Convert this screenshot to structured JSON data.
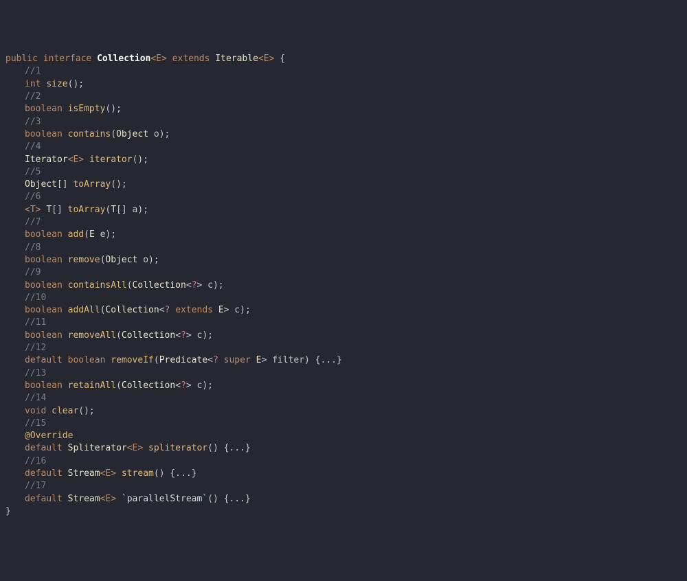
{
  "code": {
    "declaration": {
      "modifiers": "public interface",
      "name": "Collection",
      "generic": "<E>",
      "extends_kw": "extends",
      "super": "Iterable",
      "super_generic": "<E>",
      "open": "{"
    },
    "members": [
      {
        "comment": "//1",
        "tokens": [
          "int",
          " ",
          "size",
          "();"
        ]
      },
      {
        "comment": "//2",
        "tokens": [
          "boolean",
          " ",
          "isEmpty",
          "();"
        ]
      },
      {
        "comment": "//3",
        "tokens": [
          "boolean",
          " ",
          "contains",
          "(",
          "Object",
          " o);"
        ]
      },
      {
        "comment": "//4",
        "tokens": [
          "Iterator",
          "<E>",
          " ",
          "iterator",
          "();"
        ]
      },
      {
        "comment": "//5",
        "tokens": [
          "Object",
          "[] ",
          "toArray",
          "();"
        ]
      },
      {
        "comment": "//6",
        "tokens": [
          "<T>",
          " ",
          "T",
          "[] ",
          "toArray",
          "(",
          "T",
          "[] a);"
        ]
      },
      {
        "comment": "//7",
        "tokens": [
          "boolean",
          " ",
          "add",
          "(",
          "E",
          " e);"
        ]
      },
      {
        "comment": "//8",
        "tokens": [
          "boolean",
          " ",
          "remove",
          "(",
          "Object",
          " o);"
        ]
      },
      {
        "comment": "//9",
        "tokens": [
          "boolean",
          " ",
          "containsAll",
          "(",
          "Collection",
          "<",
          "?",
          "> c);"
        ]
      },
      {
        "comment": "//10",
        "tokens": [
          "boolean",
          " ",
          "addAll",
          "(",
          "Collection",
          "<",
          "?",
          " ",
          "extends",
          " ",
          "E",
          "> c);"
        ]
      },
      {
        "comment": "//11",
        "tokens": [
          "boolean",
          " ",
          "removeAll",
          "(",
          "Collection",
          "<",
          "?",
          "> c);"
        ]
      },
      {
        "comment": "//12",
        "tokens": [
          "default",
          " ",
          "boolean",
          " ",
          "removeIf",
          "(",
          "Predicate",
          "<",
          "?",
          " ",
          "super",
          " ",
          "E",
          "> filter) {...}"
        ]
      },
      {
        "comment": "//13",
        "tokens": [
          "boolean",
          " ",
          "retainAll",
          "(",
          "Collection",
          "<",
          "?",
          "> c);"
        ]
      },
      {
        "comment": "//14",
        "tokens": [
          "void",
          " ",
          "clear",
          "();"
        ]
      },
      {
        "comment": "//15",
        "annotation": "@Override",
        "tokens": [
          "default",
          " ",
          "Spliterator",
          "<E>",
          " ",
          "spliterator",
          "() {...}"
        ]
      },
      {
        "comment": "//16",
        "tokens": [
          "default",
          " ",
          "Stream",
          "<E>",
          " ",
          "stream",
          "() {...}"
        ]
      },
      {
        "comment": "//17",
        "tokens": [
          "default",
          " ",
          "Stream",
          "<E>",
          " ",
          "`parallelStream`",
          "() {...}"
        ]
      }
    ],
    "close": "}"
  }
}
